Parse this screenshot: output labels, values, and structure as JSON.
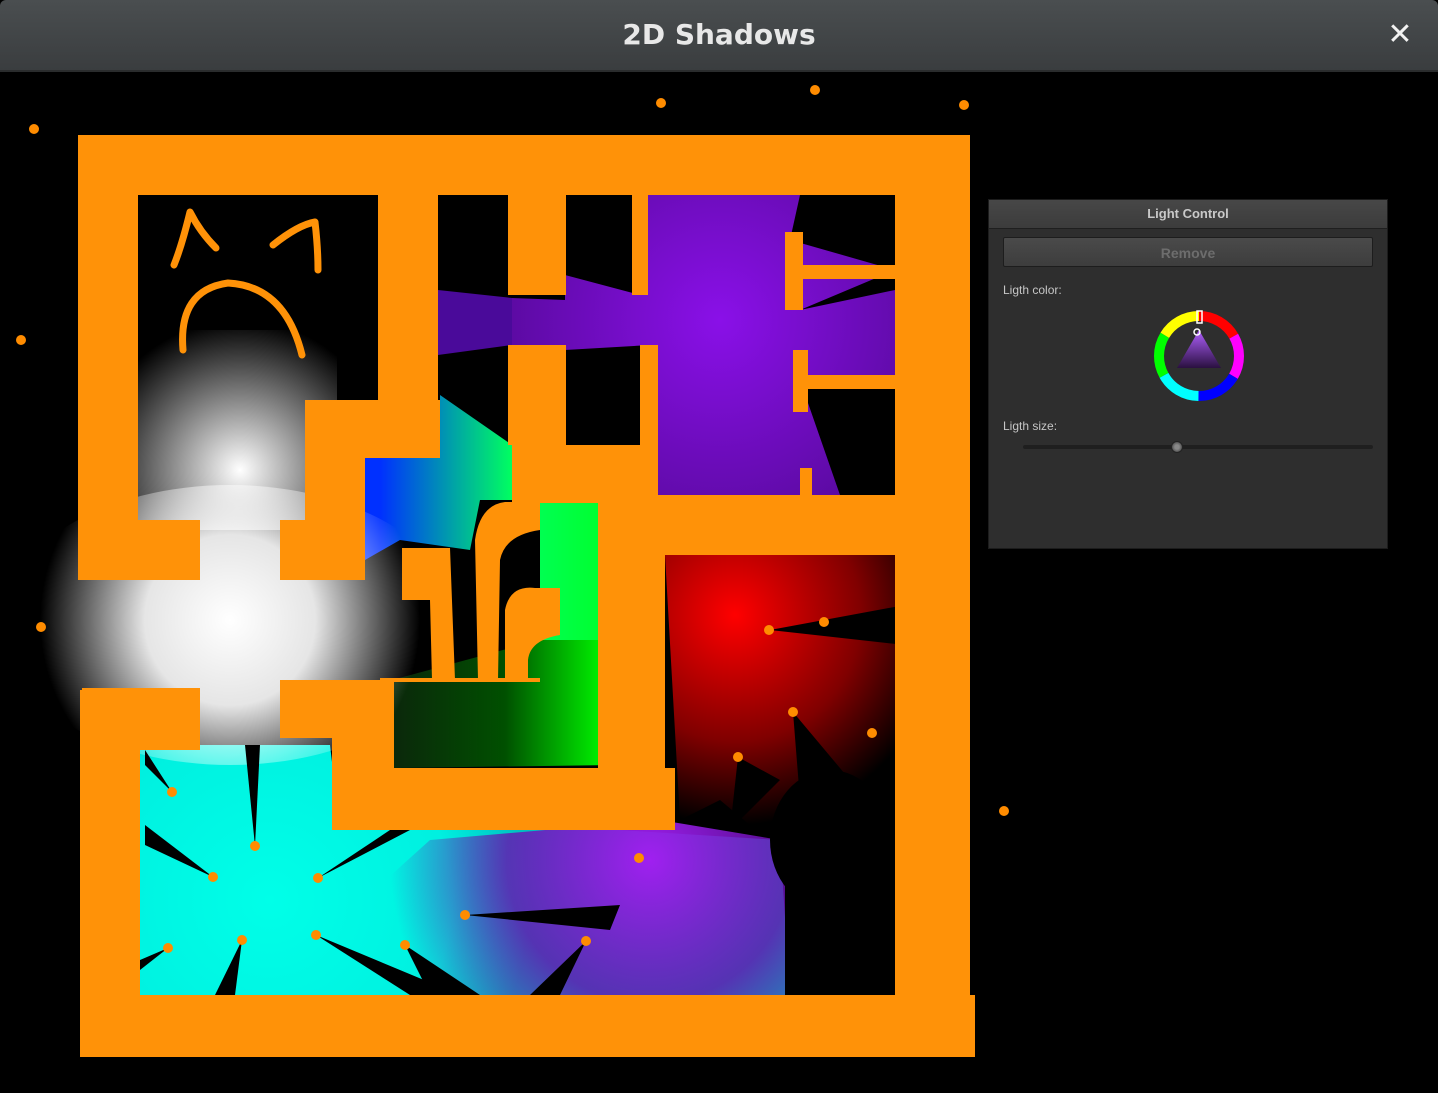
{
  "window": {
    "title": "2D Shadows",
    "close_icon": "close-icon"
  },
  "light_control": {
    "title": "Light Control",
    "remove_label": "Remove",
    "color_label": "Ligth color:",
    "size_label": "Ligth size:",
    "color_value": "#7a3fd0",
    "size_fraction": 0.44
  },
  "colors": {
    "wall": "#ff9208",
    "light_dot": "#ff8c00"
  }
}
